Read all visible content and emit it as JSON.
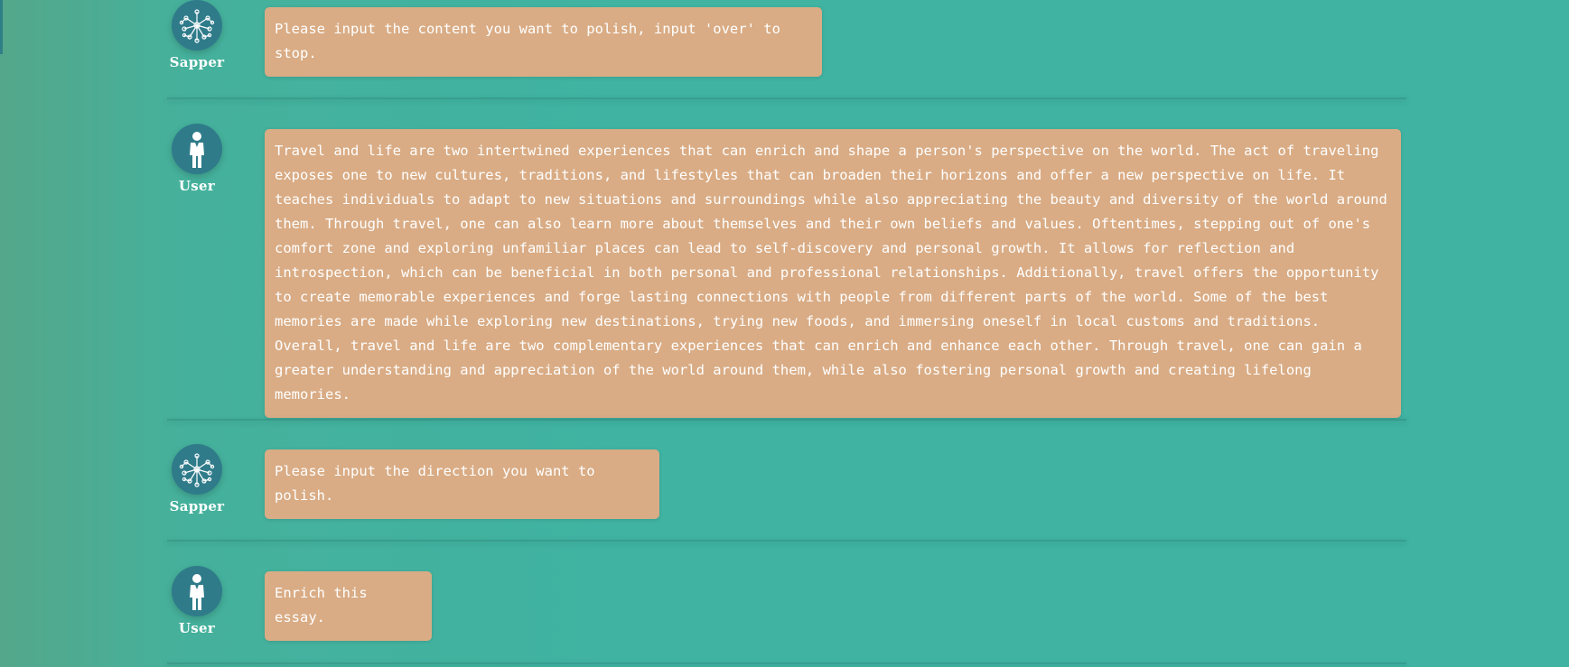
{
  "messages": [
    {
      "role": "Sapper",
      "text": "Please input the content you want to polish, input 'over' to stop."
    },
    {
      "role": "User",
      "text": "Travel and life are two intertwined experiences that can enrich and shape a person's perspective on the world. The act of traveling exposes one to new cultures, traditions, and lifestyles that can broaden their horizons and offer a new perspective on life. It teaches individuals to adapt to new situations and surroundings while also appreciating the beauty and diversity of the world around them. Through travel, one can also learn more about themselves and their own beliefs and values. Oftentimes, stepping out of one's comfort zone and exploring unfamiliar places can lead to self-discovery and personal growth. It allows for reflection and introspection, which can be beneficial in both personal and professional relationships. Additionally, travel offers the opportunity to create memorable experiences and forge lasting connections with people from different parts of the world. Some of the best memories are made while exploring new destinations, trying new foods, and immersing oneself in local customs and traditions. Overall, travel and life are two complementary experiences that can enrich and enhance each other. Through travel, one can gain a greater understanding and appreciation of the world around them, while also fostering personal growth and creating lifelong memories."
    },
    {
      "role": "Sapper",
      "text": "Please input the direction you want to polish."
    },
    {
      "role": "User",
      "text": "Enrich this essay."
    }
  ],
  "icons": {
    "sapper": "network-icon",
    "user": "person-icon"
  },
  "colors": {
    "background": "#40b3a2",
    "bubble": "#d9ac85",
    "avatar": "#2f7b8a",
    "text": "#ffffff"
  }
}
